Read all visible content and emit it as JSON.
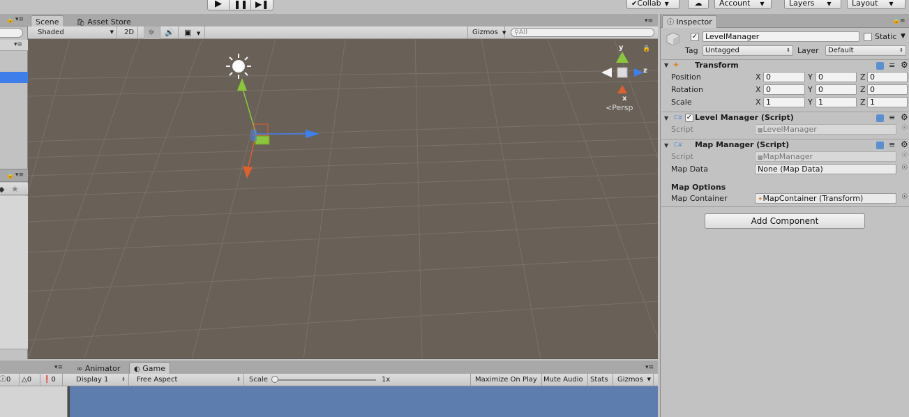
{
  "toolbar": {
    "play_icon": "play-icon",
    "pause_icon": "pause-icon",
    "step_icon": "step-icon",
    "collab": "Collab",
    "account": "Account",
    "layers": "Layers",
    "layout": "Layout"
  },
  "scene": {
    "tabs": [
      "Scene",
      "Asset Store"
    ],
    "shading_mode": "Shaded",
    "mode_2d": "2D",
    "gizmos": "Gizmos",
    "search_placeholder": "All",
    "gizmo_axes": {
      "y": "y",
      "z": "z",
      "x": "x"
    },
    "projection": "Persp"
  },
  "bottom": {
    "tabs": [
      "Animator",
      "Game"
    ],
    "display": "Display 1",
    "aspect": "Free Aspect",
    "scale_label": "Scale",
    "scale_value": "1x",
    "buttons": [
      "Maximize On Play",
      "Mute Audio",
      "Stats",
      "Gizmos"
    ],
    "console_counts": {
      "log": "0",
      "warn": "0",
      "error": "0"
    }
  },
  "inspector": {
    "tab": "Inspector",
    "object_name": "LevelManager",
    "active": true,
    "static_label": "Static",
    "static_checked": false,
    "tag_label": "Tag",
    "tag": "Untagged",
    "layer_label": "Layer",
    "layer": "Default",
    "transform": {
      "title": "Transform",
      "rows": [
        {
          "label": "Position",
          "x": "0",
          "y": "0",
          "z": "0"
        },
        {
          "label": "Rotation",
          "x": "0",
          "y": "0",
          "z": "0"
        },
        {
          "label": "Scale",
          "x": "1",
          "y": "1",
          "z": "1"
        }
      ],
      "axis_labels": [
        "X",
        "Y",
        "Z"
      ]
    },
    "level_manager": {
      "title": "Level Manager (Script)",
      "enabled": true,
      "script_label": "Script",
      "script_value": "LevelManager"
    },
    "map_manager": {
      "title": "Map Manager (Script)",
      "script_label": "Script",
      "script_value": "MapManager",
      "map_data_label": "Map Data",
      "map_data_value": "None (Map Data)",
      "options_header": "Map Options",
      "container_label": "Map Container",
      "container_value": "MapContainer (Transform)"
    },
    "add_component": "Add Component"
  },
  "colors": {
    "scene_bg": "#696158",
    "selection": "#3d7eea",
    "axis_x": "#e0602b",
    "axis_y": "#8ac63a",
    "axis_z": "#3e7ff0",
    "game_sky": "#5c7dad"
  }
}
